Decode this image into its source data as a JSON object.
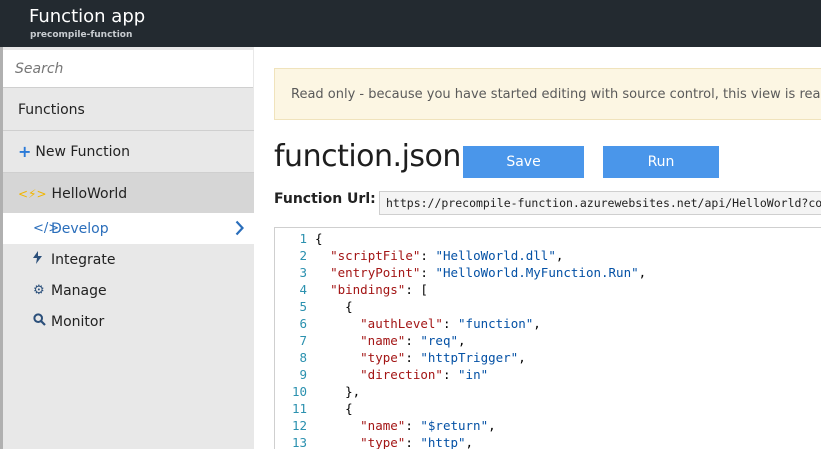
{
  "header": {
    "title": "Function app",
    "subtitle": "precompile-function"
  },
  "sidebar": {
    "search_placeholder": "Search",
    "functions_label": "Functions",
    "new_function_label": "New Function",
    "function_name": "HelloWorld",
    "subitems": {
      "develop": "Develop",
      "integrate": "Integrate",
      "manage": "Manage",
      "monitor": "Monitor"
    }
  },
  "banner": {
    "text": "Read only - because you have started editing with source control, this view is read only"
  },
  "editor": {
    "filename": "function.json",
    "save_label": "Save",
    "run_label": "Run",
    "url_label": "Function Url:",
    "url_value": "https://precompile-function.azurewebsites.net/api/HelloWorld?code=",
    "lines": [
      {
        "n": "1",
        "indent": "",
        "key": "",
        "value": "",
        "tail": "{"
      },
      {
        "n": "2",
        "indent": "  ",
        "key": "\"scriptFile\"",
        "value": "\"HelloWorld.dll\"",
        "tail": ","
      },
      {
        "n": "3",
        "indent": "  ",
        "key": "\"entryPoint\"",
        "value": "\"HelloWorld.MyFunction.Run\"",
        "tail": ","
      },
      {
        "n": "4",
        "indent": "  ",
        "key": "\"bindings\"",
        "value": "",
        "tail": ": ["
      },
      {
        "n": "5",
        "indent": "    ",
        "key": "",
        "value": "",
        "tail": "{"
      },
      {
        "n": "6",
        "indent": "      ",
        "key": "\"authLevel\"",
        "value": "\"function\"",
        "tail": ","
      },
      {
        "n": "7",
        "indent": "      ",
        "key": "\"name\"",
        "value": "\"req\"",
        "tail": ","
      },
      {
        "n": "8",
        "indent": "      ",
        "key": "\"type\"",
        "value": "\"httpTrigger\"",
        "tail": ","
      },
      {
        "n": "9",
        "indent": "      ",
        "key": "\"direction\"",
        "value": "\"in\"",
        "tail": ""
      },
      {
        "n": "10",
        "indent": "    ",
        "key": "",
        "value": "",
        "tail": "},"
      },
      {
        "n": "11",
        "indent": "    ",
        "key": "",
        "value": "",
        "tail": "{"
      },
      {
        "n": "12",
        "indent": "      ",
        "key": "\"name\"",
        "value": "\"$return\"",
        "tail": ","
      },
      {
        "n": "13",
        "indent": "      ",
        "key": "\"type\"",
        "value": "\"http\"",
        "tail": ","
      }
    ]
  },
  "colors": {
    "topbar": "#232a30",
    "accent": "#4a96ea",
    "banner_bg": "#fcf6e3"
  }
}
